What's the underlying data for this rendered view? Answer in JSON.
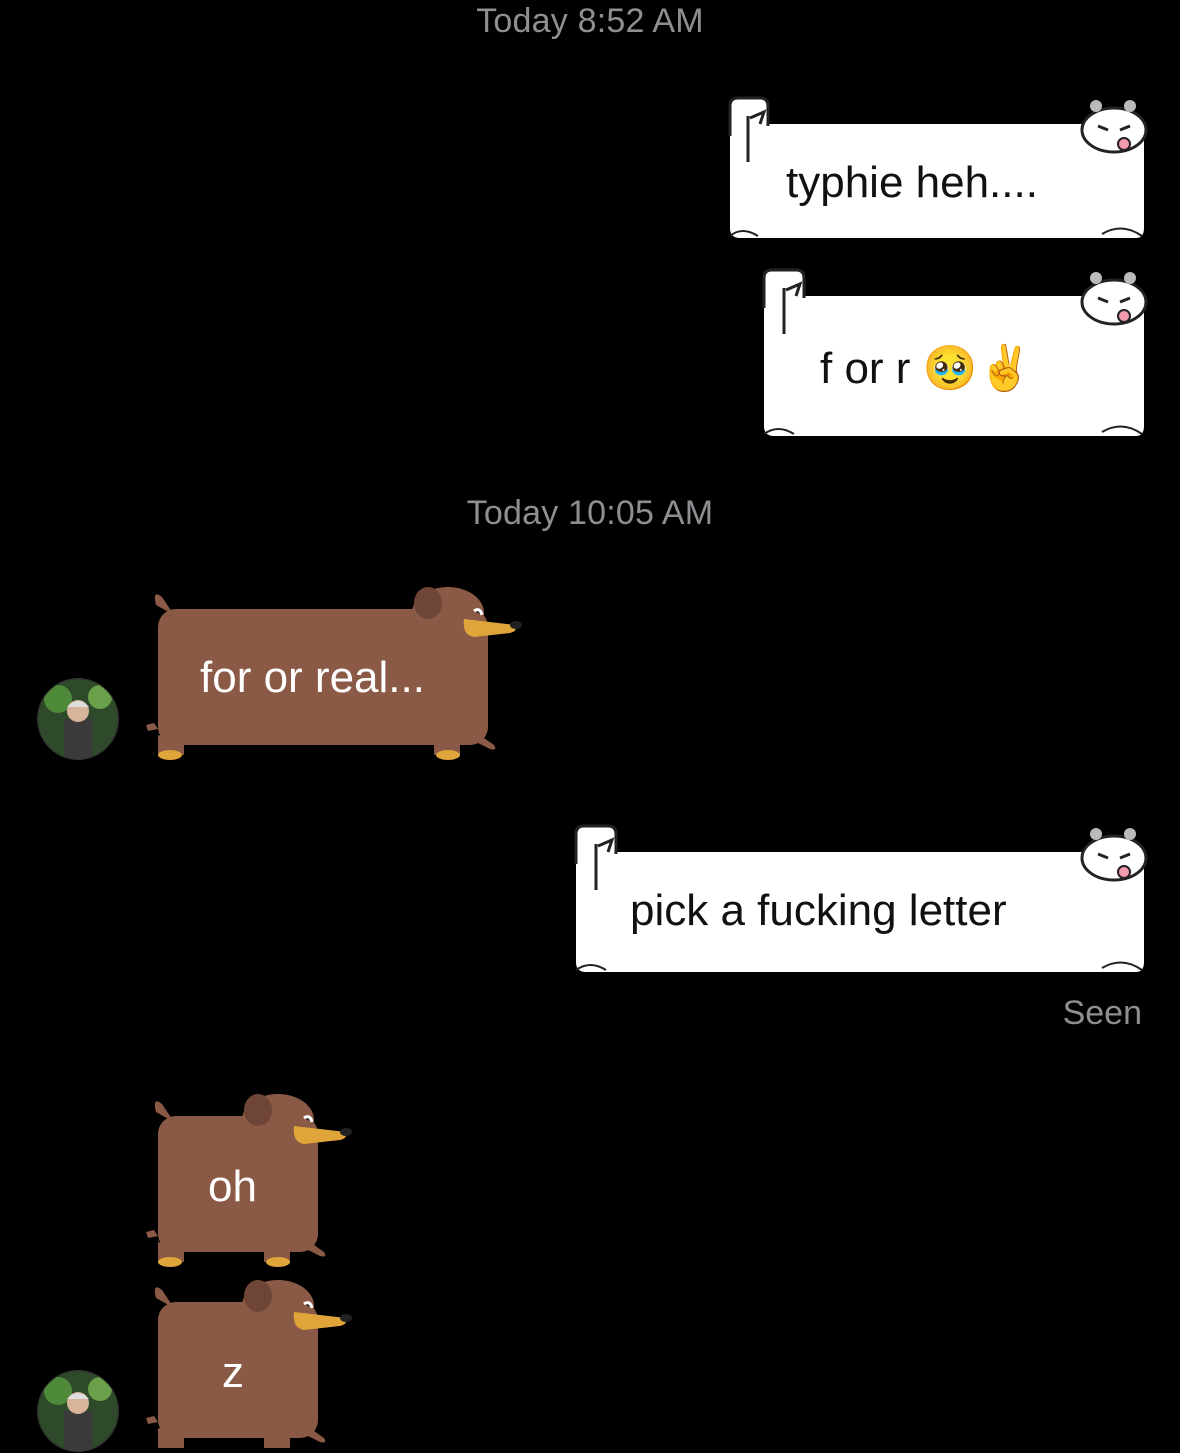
{
  "timestamps": [
    "Today 8:52 AM",
    "Today 10:05 AM"
  ],
  "messages": [
    {
      "direction": "outgoing",
      "text": "typhie heh...."
    },
    {
      "direction": "outgoing",
      "text": "f or r",
      "emoji": "🥹✌️"
    },
    {
      "direction": "incoming",
      "text": "for or real..."
    },
    {
      "direction": "outgoing",
      "text": "pick a fucking letter"
    },
    {
      "direction": "incoming",
      "text": "oh"
    },
    {
      "direction": "incoming",
      "text": "z"
    }
  ],
  "status": {
    "seen_label": "Seen"
  },
  "colors": {
    "background": "#000000",
    "outgoing_bubble": "#ffffff",
    "incoming_bubble": "#8a5a46",
    "timestamp_text": "#8e8e93",
    "dog_snout": "#e0a53a"
  },
  "icons": {
    "contact_avatar": "avatar-photo",
    "outgoing_theme": "scroll-cat",
    "incoming_theme": "dachshund"
  }
}
